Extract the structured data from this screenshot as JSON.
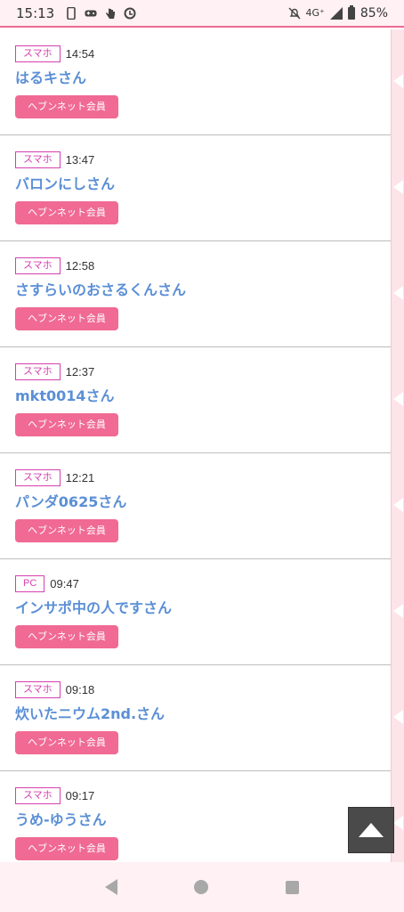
{
  "status_bar": {
    "time": "15:13",
    "network": "4G⁺",
    "battery": "85%",
    "left_icons": [
      "phone-icon",
      "gamepad-icon",
      "hand-icon",
      "update-icon"
    ],
    "right_icons": [
      "bell-off-icon",
      "signal-icon",
      "battery-icon"
    ]
  },
  "entries": [
    {
      "device": "スマホ",
      "time": "14:54",
      "name": "はるキさん",
      "member_label": "ヘブンネット会員"
    },
    {
      "device": "スマホ",
      "time": "13:47",
      "name": "バロンにしさん",
      "member_label": "ヘブンネット会員"
    },
    {
      "device": "スマホ",
      "time": "12:58",
      "name": "さすらいのおさるくんさん",
      "member_label": "ヘブンネット会員"
    },
    {
      "device": "スマホ",
      "time": "12:37",
      "name": "mkt0014さん",
      "member_label": "ヘブンネット会員"
    },
    {
      "device": "スマホ",
      "time": "12:21",
      "name": "パンダ0625さん",
      "member_label": "ヘブンネット会員"
    },
    {
      "device": "PC",
      "time": "09:47",
      "name": "インサポ中の人ですさん",
      "member_label": "ヘブンネット会員"
    },
    {
      "device": "スマホ",
      "time": "09:18",
      "name": "炊いたニウム2nd.さん",
      "member_label": "ヘブンネット会員"
    },
    {
      "device": "スマホ",
      "time": "09:17",
      "name": "うめ-ゆうさん",
      "member_label": "ヘブンネット会員"
    }
  ],
  "colors": {
    "accent": "#f06a94",
    "badge": "#d63fb0",
    "name": "#5b8fd6"
  },
  "nav": {
    "icons": [
      "back-icon",
      "home-icon",
      "recents-icon"
    ]
  }
}
